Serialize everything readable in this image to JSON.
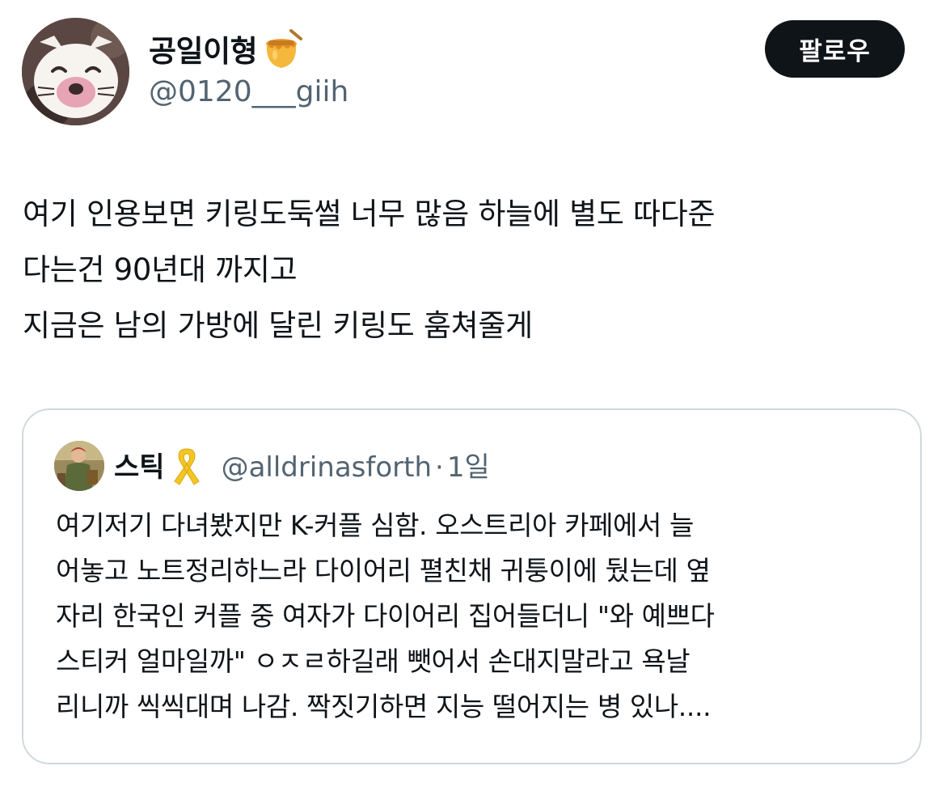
{
  "author": {
    "display_name": "공일이형",
    "handle": "@0120___giih",
    "name_emoji": "honey-pot-icon"
  },
  "follow_button": {
    "label": "팔로우"
  },
  "tweet": {
    "lines": [
      "여기 인용보면 키링도둑썰 너무 많음 하늘에 별도 따다준",
      "다는건 90년대 까지고",
      "지금은 남의 가방에 달린 키링도 훔쳐줄게"
    ]
  },
  "quoted_tweet": {
    "display_name": "스틱",
    "name_emoji": "yellow-ribbon-icon",
    "handle": "@alldrinasforth",
    "separator": "·",
    "time": "1일",
    "lines": [
      "여기저기 다녀봤지만 K-커플 심함. 오스트리아 카페에서 늘",
      "어놓고 노트정리하느라 다이어리 펼친채 귀퉁이에 뒀는데 옆",
      "자리 한국인 커플 중 여자가 다이어리 집어들더니 \"와 예쁘다",
      "스티커 얼마일까\" ㅇㅈㄹ하길래 뺏어서 손대지말라고 욕날",
      "리니까 씩씩대며 나감. 짝짓기하면 지능 떨어지는 병 있나...."
    ]
  },
  "colors": {
    "text_primary": "#0f1419",
    "text_secondary": "#536471",
    "border": "#cfd9de",
    "button_bg": "#0f1419",
    "button_text": "#ffffff"
  }
}
